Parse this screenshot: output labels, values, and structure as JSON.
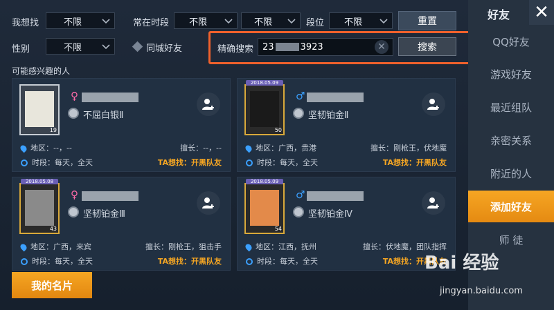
{
  "filters": {
    "want_label": "我想找",
    "want_value": "不限",
    "online_label": "常在时段",
    "online_value1": "不限",
    "online_value2": "不限",
    "tier_label": "段位",
    "tier_value": "不限",
    "reset_label": "重置",
    "gender_label": "性别",
    "gender_value": "不限",
    "samecity_label": "同城好友",
    "exact_label": "精确搜索",
    "search_value_pre": "23",
    "search_value_post": "3923",
    "search_button": "搜索"
  },
  "section_title": "可能感兴趣的人",
  "cards": [
    {
      "gender": "♀",
      "gender_color": "#ff6aa8",
      "rank": "不屈白银Ⅱ",
      "level": "19",
      "region": "地区：--，--",
      "skill": "擅长：--，--",
      "time": "时段：每天，全天",
      "want": "TA想找：开黑队友",
      "frame": "silver",
      "date": ""
    },
    {
      "gender": "♂",
      "gender_color": "#3ba0ff",
      "rank": "坚韧铂金Ⅱ",
      "level": "50",
      "region": "地区：广西，贵港",
      "skill": "擅长：刚枪王，伏地魔",
      "time": "时段：每天，全天",
      "want": "TA想找：开黑队友",
      "frame": "gold",
      "date": "2018.05.09"
    },
    {
      "gender": "♀",
      "gender_color": "#ff6aa8",
      "rank": "坚韧铂金Ⅲ",
      "level": "43",
      "region": "地区：广西，来宾",
      "skill": "擅长：刚枪王，狙击手",
      "time": "时段：每天，全天",
      "want": "TA想找：开黑队友",
      "frame": "gold",
      "date": "2018.05.08"
    },
    {
      "gender": "♂",
      "gender_color": "#3ba0ff",
      "rank": "坚韧铂金Ⅳ",
      "level": "54",
      "region": "地区：江西，抚州",
      "skill": "擅长：伏地魔，团队指挥",
      "time": "时段：每天，全天",
      "want": "TA想找：开黑队友",
      "frame": "gold",
      "date": "2018.05.09"
    }
  ],
  "my_card": "我的名片",
  "nav": {
    "title": "好友",
    "close": "✕",
    "items": [
      "QQ好友",
      "游戏好友",
      "最近组队",
      "亲密关系",
      "附近的人",
      "添加好友",
      "师  徒"
    ],
    "active_index": 5
  },
  "watermark": {
    "logo": "Bai 经验",
    "url": "jingyan.baidu.com"
  },
  "colors": {
    "accent": "#f6a623",
    "highlight": "#f0612c"
  }
}
